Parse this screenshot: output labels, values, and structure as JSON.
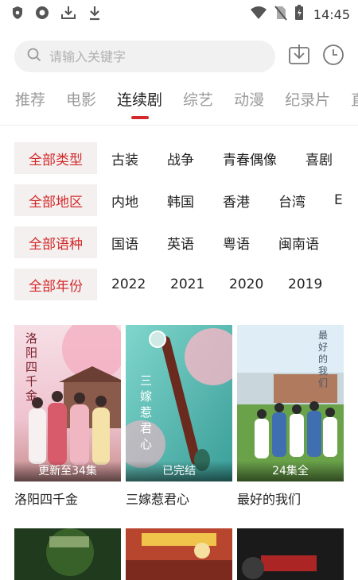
{
  "status_bar": {
    "time": "14:45",
    "left_icons": [
      "shield-icon",
      "circle-app-icon",
      "download-tray-icon",
      "download-arrow-icon"
    ],
    "right_icons": [
      "wifi-icon",
      "no-sim-icon",
      "battery-icon"
    ]
  },
  "search": {
    "placeholder": "请输入关键字"
  },
  "header_icons": [
    "download-icon",
    "history-clock-icon"
  ],
  "tabs": [
    {
      "label": "推荐",
      "active": false
    },
    {
      "label": "电影",
      "active": false
    },
    {
      "label": "连续剧",
      "active": true
    },
    {
      "label": "综艺",
      "active": false
    },
    {
      "label": "动漫",
      "active": false
    },
    {
      "label": "纪录片",
      "active": false
    },
    {
      "label": "直",
      "active": false
    }
  ],
  "filters": [
    {
      "active": "全部类型",
      "options": [
        "古装",
        "战争",
        "青春偶像",
        "喜剧"
      ]
    },
    {
      "active": "全部地区",
      "options": [
        "内地",
        "韩国",
        "香港",
        "台湾",
        "E"
      ]
    },
    {
      "active": "全部语种",
      "options": [
        "国语",
        "英语",
        "粤语",
        "闽南语"
      ]
    },
    {
      "active": "全部年份",
      "options": [
        "2022",
        "2021",
        "2020",
        "2019"
      ]
    }
  ],
  "shows": [
    {
      "title": "洛阳四千金",
      "badge": "更新至34集",
      "poster_text": "洛阳四千金"
    },
    {
      "title": "三嫁惹君心",
      "badge": "已完结",
      "poster_text": "三嫁惹君心"
    },
    {
      "title": "最好的我们",
      "badge": "24集全",
      "poster_text": "最好的我们"
    }
  ],
  "colors": {
    "accent": "#d22a2a",
    "active_filter_bg": "#f5f0f0",
    "search_bg": "#f1f1f1",
    "inactive_tab": "#9a9a9a"
  }
}
